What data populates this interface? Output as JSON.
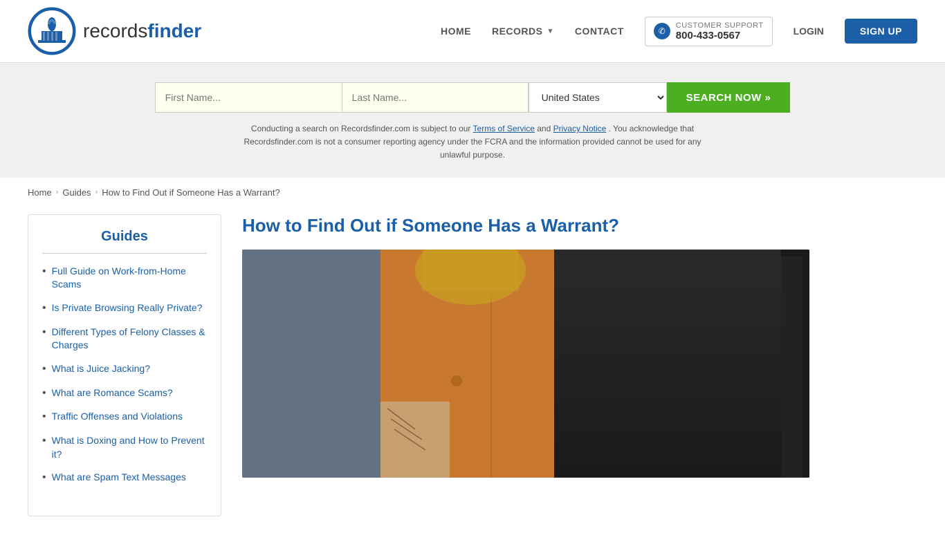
{
  "header": {
    "logo_records": "records",
    "logo_finder": "finder",
    "nav": {
      "home": "HOME",
      "records": "RECORDS",
      "contact": "CONTACT",
      "support_label": "CUSTOMER SUPPORT",
      "support_phone": "800-433-0567",
      "login": "LOGIN",
      "signup": "SIGN UP"
    }
  },
  "search": {
    "first_name_placeholder": "First Name...",
    "last_name_placeholder": "Last Name...",
    "country": "United States",
    "search_btn": "SEARCH NOW »",
    "disclaimer": "Conducting a search on Recordsfinder.com is subject to our",
    "tos_link": "Terms of Service",
    "and": "and",
    "privacy_link": "Privacy Notice",
    "disclaimer2": ". You acknowledge that Recordsfinder.com is not a consumer reporting agency under the FCRA and the information provided cannot be used for any unlawful purpose."
  },
  "breadcrumb": {
    "home": "Home",
    "guides": "Guides",
    "current": "How to Find Out if Someone Has a Warrant?"
  },
  "sidebar": {
    "title": "Guides",
    "items": [
      {
        "label": "Full Guide on Work-from-Home Scams"
      },
      {
        "label": "Is Private Browsing Really Private?"
      },
      {
        "label": "Different Types of Felony Classes & Charges"
      },
      {
        "label": "What is Juice Jacking?"
      },
      {
        "label": "What are Romance Scams?"
      },
      {
        "label": "Traffic Offenses and Violations"
      },
      {
        "label": "What is Doxing and How to Prevent it?"
      },
      {
        "label": "What are Spam Text Messages"
      }
    ]
  },
  "article": {
    "title": "How to Find Out if Someone Has a Warrant?",
    "image_alt": "Person in orange jumpsuit with police officer"
  }
}
